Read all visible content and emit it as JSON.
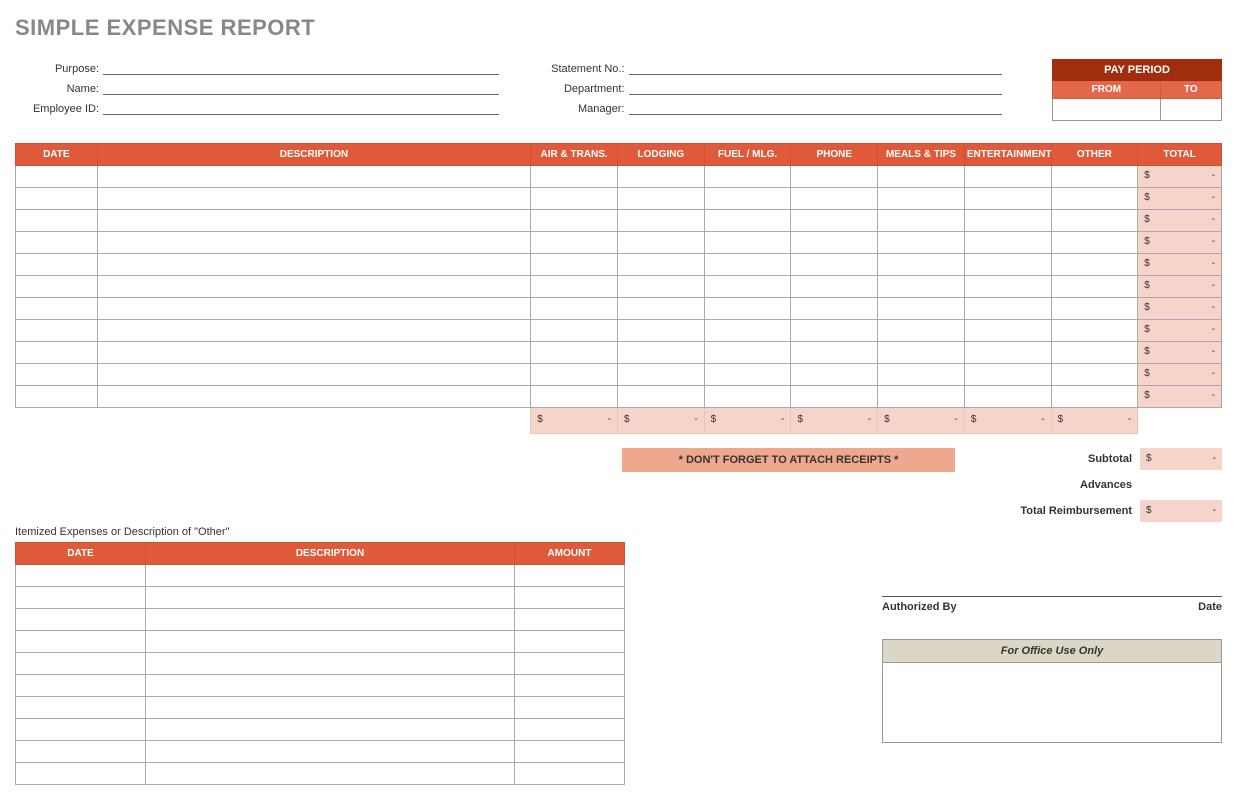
{
  "title": "SIMPLE EXPENSE REPORT",
  "header_fields": {
    "purpose": "Purpose:",
    "name": "Name:",
    "employee_id": "Employee ID:",
    "statement_no": "Statement No.:",
    "department": "Department:",
    "manager": "Manager:"
  },
  "pay_period": {
    "title": "PAY PERIOD",
    "from": "FROM",
    "to": "TO"
  },
  "main_table": {
    "headers": {
      "date": "DATE",
      "description": "DESCRIPTION",
      "air": "AIR & TRANS.",
      "lodging": "LODGING",
      "fuel": "FUEL / MLG.",
      "phone": "PHONE",
      "meals": "MEALS & TIPS",
      "entertainment": "ENTERTAINMENT",
      "other": "OTHER",
      "total": "TOTAL"
    },
    "row_count": 11,
    "currency": "$",
    "empty_value": "-",
    "column_totals": [
      "$",
      "$",
      "$",
      "$",
      "$",
      "$",
      "$"
    ]
  },
  "receipts_note": "* DON'T FORGET TO ATTACH RECEIPTS *",
  "summary": {
    "subtotal": "Subtotal",
    "advances": "Advances",
    "total_reimbursement": "Total Reimbursement"
  },
  "itemized": {
    "caption": "Itemized Expenses or Description of \"Other\"",
    "headers": {
      "date": "DATE",
      "description": "DESCRIPTION",
      "amount": "AMOUNT"
    },
    "row_count": 10
  },
  "signature": {
    "authorized_by": "Authorized By",
    "date": "Date"
  },
  "office_use": "For Office Use Only"
}
